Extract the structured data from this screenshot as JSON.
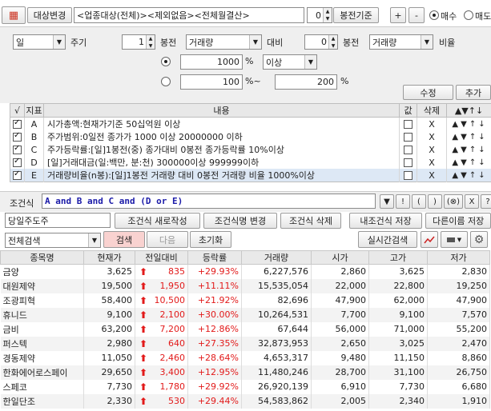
{
  "toolbar": {
    "target_label": "대상변경",
    "target_value": "<업종대상(전체)><제외없음><전체월결산>",
    "offset": "0",
    "basis": "봉전기준",
    "plus": "+",
    "minus": "-",
    "buy": "매수",
    "sell": "매도"
  },
  "period": {
    "unit": "일",
    "unit_label": "주기"
  },
  "form": {
    "bars_ago1": "1",
    "bars_label1": "봉전",
    "field1": "거래량",
    "compare": "대비",
    "bars_ago2": "0",
    "bars_label2": "봉전",
    "field2": "거래량",
    "ratio": "비율",
    "val1": "1000",
    "pct1": "%",
    "cmp1": "이상",
    "val2": "100",
    "pct2": "%~",
    "val3": "200",
    "pct3": "%",
    "edit": "수정",
    "add": "추가"
  },
  "cond_table": {
    "headers": [
      "√",
      "지표",
      "내용",
      "값",
      "삭제",
      "▲▼↑↓"
    ],
    "rows": [
      {
        "id": "A",
        "text": "시가총액:현재가기준 50십억원 이상"
      },
      {
        "id": "B",
        "text": "주가범위:0일전 종가가 1000 이상 20000000 이하"
      },
      {
        "id": "C",
        "text": "주가등락률:[일]1봉전(중) 종가대비 0봉전 종가등락률 10%이상"
      },
      {
        "id": "D",
        "text": "[일]거래대금(일:백만, 분:천) 300000이상 999999이하"
      },
      {
        "id": "E",
        "text": "거래량비율(n봉):[일]1봉전 거래량 대비 0봉전 거래량 비율 1000%이상"
      }
    ],
    "x_mark": "X",
    "up": "▲",
    "down": "▼",
    "top": "↑",
    "bottom": "↓"
  },
  "formula": {
    "label": "조건식",
    "expr": "A and B and C and (D or E)",
    "ops": [
      "▼",
      "!",
      "(",
      ")",
      "(⊗)",
      "X",
      "?"
    ]
  },
  "actions": {
    "name": "당일주도주",
    "new": "조건식 새로작성",
    "change": "조건식명 변경",
    "delete": "조건식 삭제",
    "save_mine": "내조건식 저장",
    "save_as": "다른이름 저장"
  },
  "search": {
    "mode": "전체검색",
    "search": "검색",
    "next": "다음",
    "reset": "초기화",
    "realtime": "실시간검색"
  },
  "result": {
    "headers": [
      "종목명",
      "현재가",
      "전일대비",
      "등락률",
      "거래량",
      "시가",
      "고가",
      "저가"
    ],
    "rows": [
      {
        "name": "금양",
        "price": "3,625",
        "chg": "835",
        "rate": "+29.93%",
        "vol": "6,227,576",
        "open": "2,860",
        "high": "3,625",
        "low": "2,830"
      },
      {
        "name": "대원제약",
        "price": "19,500",
        "chg": "1,950",
        "rate": "+11.11%",
        "vol": "15,535,054",
        "open": "22,000",
        "high": "22,800",
        "low": "19,250"
      },
      {
        "name": "조광피혁",
        "price": "58,400",
        "chg": "10,500",
        "rate": "+21.92%",
        "vol": "82,696",
        "open": "47,900",
        "high": "62,000",
        "low": "47,900"
      },
      {
        "name": "휴니드",
        "price": "9,100",
        "chg": "2,100",
        "rate": "+30.00%",
        "vol": "10,264,531",
        "open": "7,700",
        "high": "9,100",
        "low": "7,570"
      },
      {
        "name": "금비",
        "price": "63,200",
        "chg": "7,200",
        "rate": "+12.86%",
        "vol": "67,644",
        "open": "56,000",
        "high": "71,000",
        "low": "55,200"
      },
      {
        "name": "퍼스텍",
        "price": "2,980",
        "chg": "640",
        "rate": "+27.35%",
        "vol": "32,873,953",
        "open": "2,650",
        "high": "3,025",
        "low": "2,470"
      },
      {
        "name": "경동제약",
        "price": "11,050",
        "chg": "2,460",
        "rate": "+28.64%",
        "vol": "4,653,317",
        "open": "9,480",
        "high": "11,150",
        "low": "8,860"
      },
      {
        "name": "한화에어로스페이",
        "price": "29,650",
        "chg": "3,400",
        "rate": "+12.95%",
        "vol": "11,480,246",
        "open": "28,700",
        "high": "31,100",
        "low": "26,750"
      },
      {
        "name": "스페코",
        "price": "7,730",
        "chg": "1,780",
        "rate": "+29.92%",
        "vol": "26,920,139",
        "open": "6,910",
        "high": "7,730",
        "low": "6,680"
      },
      {
        "name": "한일단조",
        "price": "2,330",
        "chg": "530",
        "rate": "+29.44%",
        "vol": "54,583,862",
        "open": "2,005",
        "high": "2,340",
        "low": "1,910"
      }
    ]
  },
  "colors": {
    "up": "#e21a1a",
    "search_bg": "#f9d2d0"
  }
}
